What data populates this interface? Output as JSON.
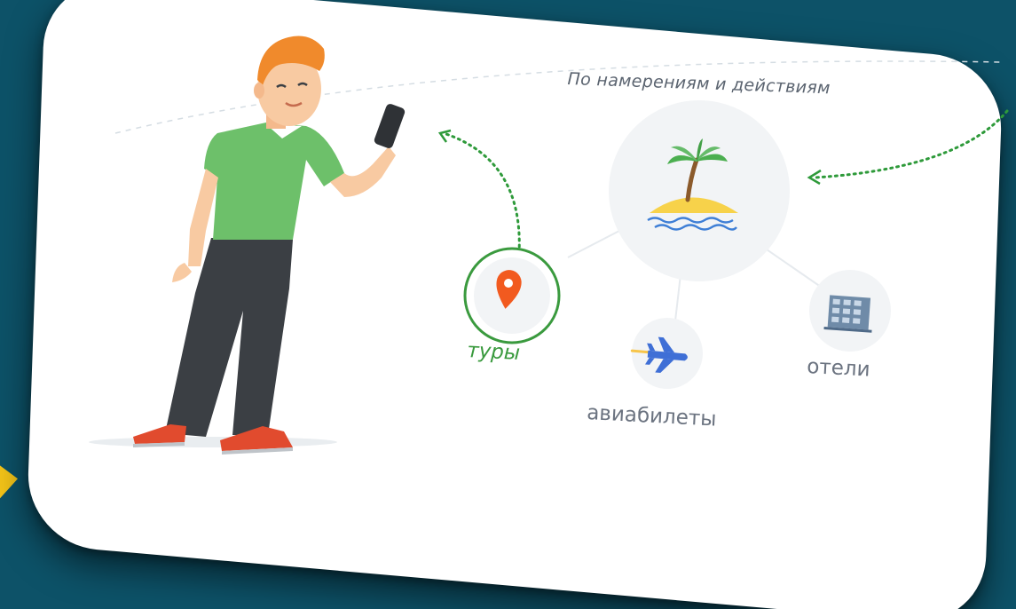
{
  "heading": "По намерениям и действиям",
  "categories": {
    "tours": "туры",
    "flights": "авиабилеты",
    "hotels": "отели"
  },
  "icons": {
    "center": "palm-island-icon",
    "tours": "location-pin-icon",
    "flights": "airplane-icon",
    "hotels": "hotel-building-icon"
  },
  "colors": {
    "background": "#0d5268",
    "accent_green": "#3a9a3e",
    "pin_orange": "#f25a1f"
  }
}
